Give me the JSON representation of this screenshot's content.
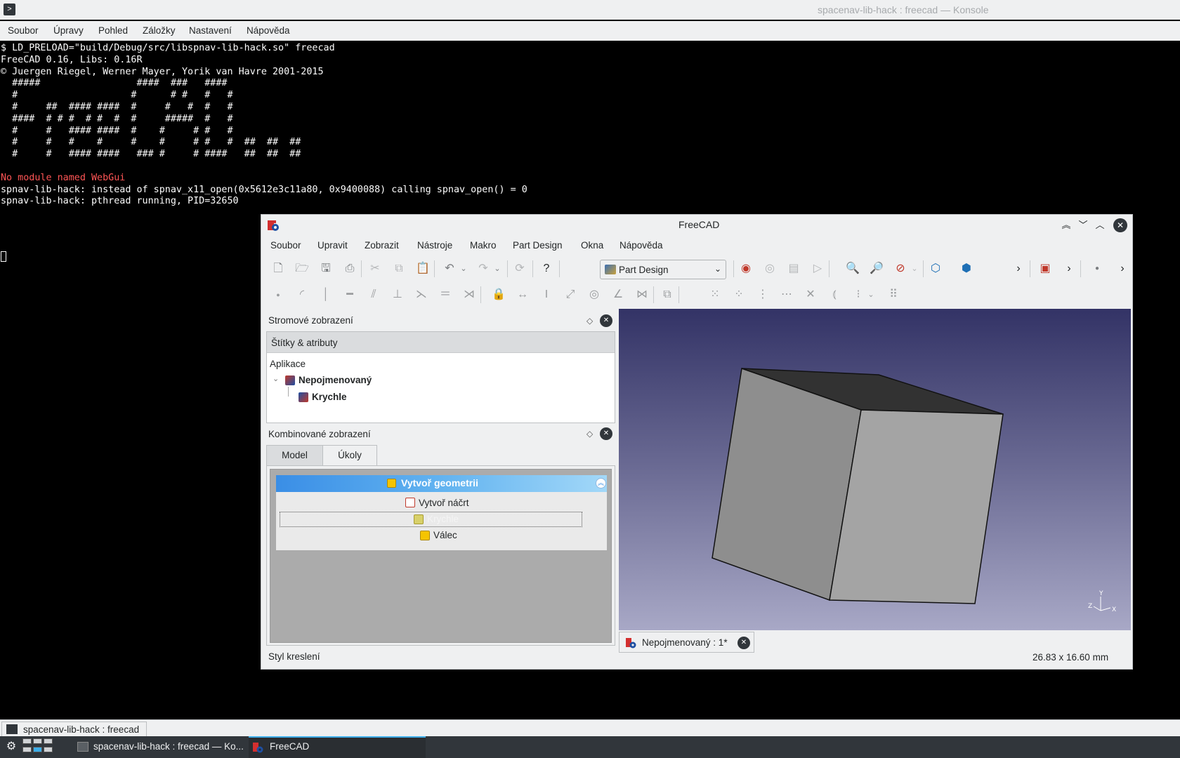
{
  "konsole": {
    "title": "spacenav-lib-hack : freecad — Konsole",
    "menu": [
      "Soubor",
      "Úpravy",
      "Pohled",
      "Záložky",
      "Nastavení",
      "Nápověda"
    ],
    "terminal_lines": [
      "$ LD_PRELOAD=\"build/Debug/src/libspnav-lib-hack.so\" freecad",
      "FreeCAD 0.16, Libs: 0.16R",
      "© Juergen Riegel, Werner Mayer, Yorik van Havre 2001-2015",
      "  #####                 ####  ###   ####",
      "  #                    #      # #   #   #",
      "  #     ##  #### ####  #     #   #  #   #",
      "  ####  # # #  # #  #  #     #####  #   #",
      "  #     #   #### ####  #    #     # #   #",
      "  #     #   #    #     #    #     # #   #  ##  ##  ##",
      "  #     #   #### ####   ### #     # ####   ##  ##  ##",
      ""
    ],
    "error_line": "No module named WebGui",
    "trailing_lines": [
      "spnav-lib-hack: instead of spnav_x11_open(0x5612e3c11a80, 0x9400088) calling spnav_open() = 0",
      "spnav-lib-hack: pthread running, PID=32650"
    ],
    "tab_label": "spacenav-lib-hack : freecad"
  },
  "freecad": {
    "title": "FreeCAD",
    "menu": [
      "Soubor",
      "Upravit",
      "Zobrazit",
      "Nástroje",
      "Makro",
      "Part Design",
      "Okna",
      "Nápověda"
    ],
    "workbench": "Part Design",
    "tree_panel": {
      "title": "Stromové zobrazení",
      "column_header": "Štítky & atributy",
      "root": "Aplikace",
      "document": "Nepojmenovaný",
      "child": "Krychle"
    },
    "combo_panel": {
      "title": "Kombinované zobrazení",
      "tabs": [
        "Model",
        "Úkoly"
      ],
      "task_title": "Vytvoř geometrii",
      "task_items": [
        "Vytvoř náčrt",
        "Krychle",
        "Válec"
      ]
    },
    "doc_tab": "Nepojmenovaný : 1*",
    "status_left": "Styl kreslení",
    "status_right": "26.83 x 16.60 mm",
    "axis_labels": [
      "Y",
      "Z",
      "X"
    ]
  },
  "taskbar": {
    "tasks": [
      "spacenav-lib-hack : freecad — Ko...",
      "FreeCAD"
    ]
  },
  "colors": {
    "task_header": "#3a8ee6",
    "terminal_error": "#ff5555",
    "view_top": "#333366",
    "view_bottom": "#a8a8c6"
  }
}
